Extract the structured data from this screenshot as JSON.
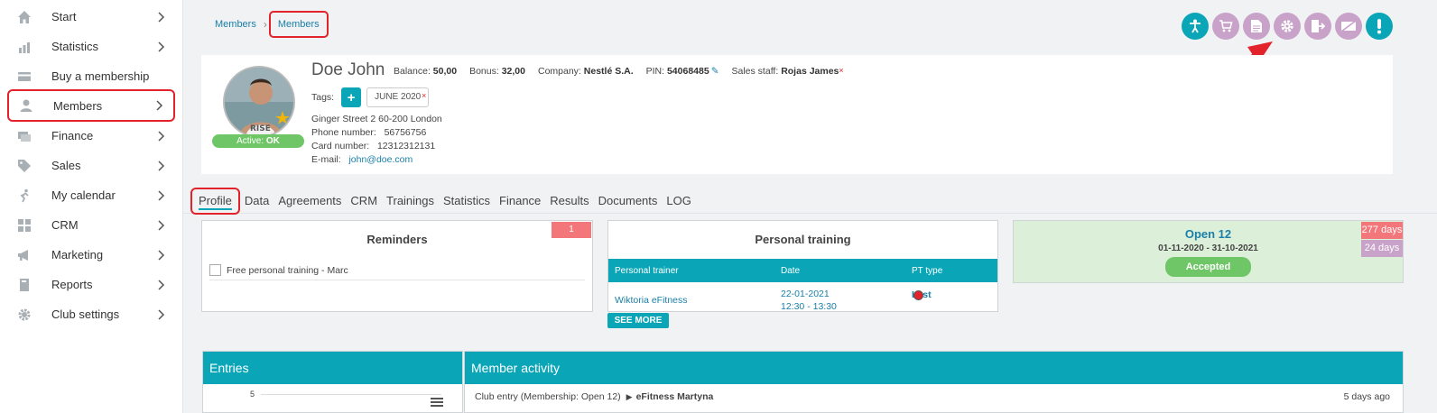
{
  "sidebar": {
    "items": [
      {
        "label": "Start",
        "icon": "home-icon",
        "chevron": true
      },
      {
        "label": "Statistics",
        "icon": "chart-icon",
        "chevron": true
      },
      {
        "label": "Buy a membership",
        "icon": "card-icon",
        "chevron": false
      },
      {
        "label": "Members",
        "icon": "user-icon",
        "chevron": true
      },
      {
        "label": "Finance",
        "icon": "money-icon",
        "chevron": true
      },
      {
        "label": "Sales",
        "icon": "tag-icon",
        "chevron": true
      },
      {
        "label": "My calendar",
        "icon": "runner-icon",
        "chevron": true
      },
      {
        "label": "CRM",
        "icon": "grid-icon",
        "chevron": true
      },
      {
        "label": "Marketing",
        "icon": "megaphone-icon",
        "chevron": true
      },
      {
        "label": "Reports",
        "icon": "book-icon",
        "chevron": true
      },
      {
        "label": "Club settings",
        "icon": "gear-icon",
        "chevron": true
      }
    ],
    "active_index": 3
  },
  "breadcrumb": [
    "Members",
    "Members"
  ],
  "actions": [
    "trainer-icon",
    "cart-icon",
    "document-icon",
    "gear-icon",
    "exit-icon",
    "card-off-icon",
    "alert-icon"
  ],
  "member": {
    "name": "Doe John",
    "balance_label": "Balance:",
    "balance": "50,00",
    "bonus_label": "Bonus:",
    "bonus": "32,00",
    "company_label": "Company:",
    "company": "Nestlé S.A.",
    "pin_label": "PIN:",
    "pin": "54068485",
    "staff_label": "Sales staff:",
    "staff": "Rojas James",
    "status_label": "Active:",
    "status": "OK",
    "tags_label": "Tags:",
    "tag": "JUNE 2020",
    "address": "Ginger Street 2 60-200 London",
    "phone_label": "Phone number:",
    "phone": "56756756",
    "card_label": "Card number:",
    "card": "12312312131",
    "email_label": "E-mail:",
    "email": "john@doe.com"
  },
  "tabs": [
    "Profile",
    "Data",
    "Agreements",
    "CRM",
    "Trainings",
    "Statistics",
    "Finance",
    "Results",
    "Documents",
    "LOG"
  ],
  "reminders": {
    "title": "Reminders",
    "count": "1",
    "items": [
      "Free personal training - Marc"
    ]
  },
  "personal_training": {
    "title": "Personal training",
    "columns": [
      "Personal trainer",
      "Date",
      "PT type"
    ],
    "row": {
      "trainer": "Wiktoria eFitness",
      "date": "22-01-2021",
      "time": "12:30 - 13:30",
      "type": "Last"
    },
    "see_more": "SEE MORE"
  },
  "membership": {
    "title": "Open 12",
    "dates": "01-11-2020 - 31-10-2021",
    "status": "Accepted",
    "days_total": "277 days",
    "days_left": "24 days"
  },
  "entries": {
    "title": "Entries",
    "axis_top": "5"
  },
  "activity": {
    "title": "Member activity",
    "row_text": "Club entry (Membership: Open 12)",
    "row_name": "eFitness Martyna",
    "row_time": "5 days ago"
  },
  "colors": {
    "accent": "#0aa6b8",
    "highlight": "#e2232b",
    "success": "#6fc667",
    "lilac": "#c9a2c9"
  }
}
